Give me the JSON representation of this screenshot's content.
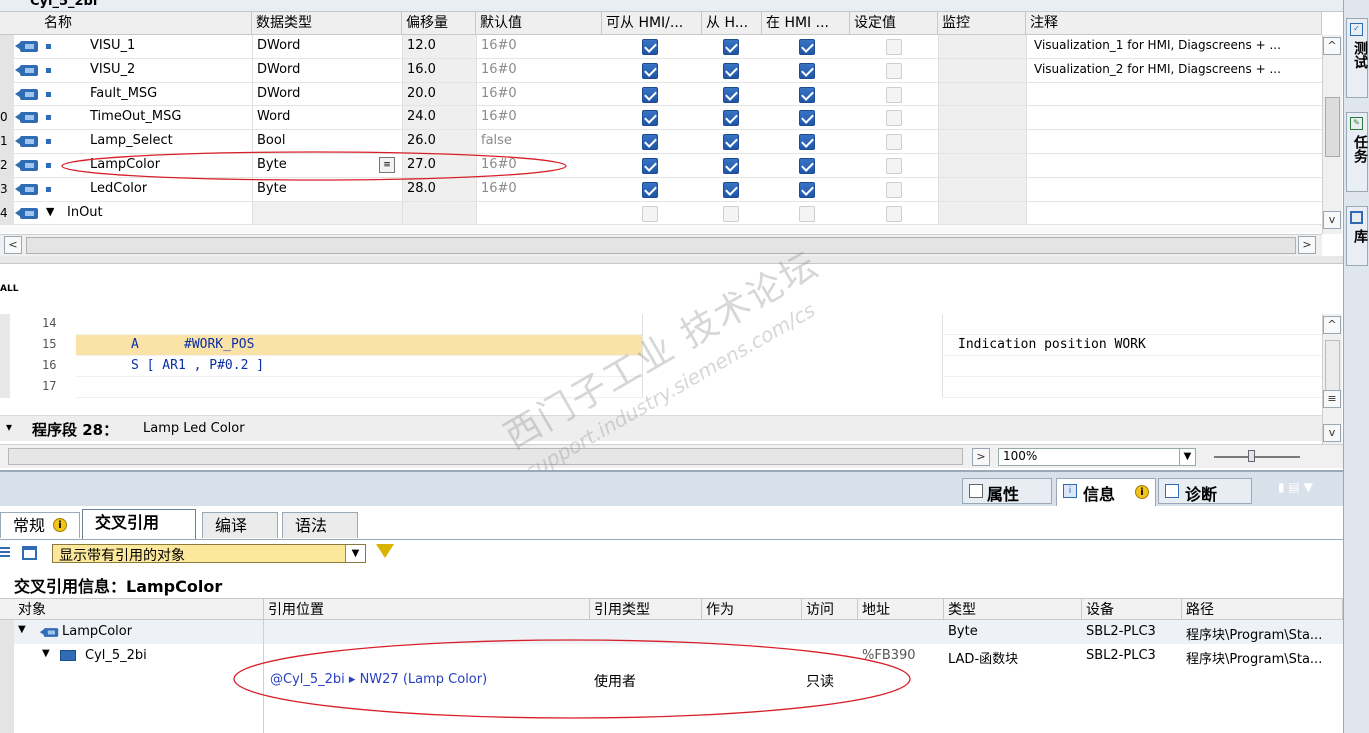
{
  "top_title": "Cyl_5_2bi",
  "interface_table": {
    "headers": [
      "名称",
      "数据类型",
      "偏移量",
      "默认值",
      "可从 HMI/...",
      "从 H...",
      "在 HMI ...",
      "设定值",
      "监控",
      "注释"
    ],
    "rows": [
      {
        "num": "",
        "name": "VISU_1",
        "type": "DWord",
        "offset": "12.0",
        "default": "16#0",
        "hmi1": true,
        "hmi2": true,
        "hmi3": true,
        "comment": "Visualization_1 for HMI, Diagscreens + ..."
      },
      {
        "num": "",
        "name": "VISU_2",
        "type": "DWord",
        "offset": "16.0",
        "default": "16#0",
        "hmi1": true,
        "hmi2": true,
        "hmi3": true,
        "comment": "Visualization_2 for HMI, Diagscreens + ..."
      },
      {
        "num": "",
        "name": "Fault_MSG",
        "type": "DWord",
        "offset": "20.0",
        "default": "16#0",
        "hmi1": true,
        "hmi2": true,
        "hmi3": true,
        "comment": ""
      },
      {
        "num": "0",
        "name": "TimeOut_MSG",
        "type": "Word",
        "offset": "24.0",
        "default": "16#0",
        "hmi1": true,
        "hmi2": true,
        "hmi3": true,
        "comment": ""
      },
      {
        "num": "1",
        "name": "Lamp_Select",
        "type": "Bool",
        "offset": "26.0",
        "default": "false",
        "hmi1": true,
        "hmi2": true,
        "hmi3": true,
        "comment": ""
      },
      {
        "num": "2",
        "name": "LampColor",
        "type": "Byte",
        "offset": "27.0",
        "default": "16#0",
        "hmi1": true,
        "hmi2": true,
        "hmi3": true,
        "comment": ""
      },
      {
        "num": "3",
        "name": "LedColor",
        "type": "Byte",
        "offset": "28.0",
        "default": "16#0",
        "hmi1": true,
        "hmi2": true,
        "hmi3": true,
        "comment": ""
      },
      {
        "num": "4",
        "name": "InOut",
        "type": "",
        "offset": "",
        "default": "",
        "hmi1": false,
        "hmi2": false,
        "hmi3": false,
        "comment": ""
      }
    ]
  },
  "side_tabs": [
    "测试",
    "任务",
    "库"
  ],
  "code": {
    "call_label": "ALL",
    "lines": [
      {
        "num": "14",
        "op": "",
        "arg": "",
        "comment": ""
      },
      {
        "num": "15",
        "op": "A",
        "arg": "#WORK_POS",
        "comment": "Indication position WORK"
      },
      {
        "num": "16",
        "op": "S [ AR1 , P#0.2 ]",
        "arg": "",
        "comment": ""
      },
      {
        "num": "17",
        "op": "",
        "arg": "",
        "comment": ""
      }
    ],
    "network_label": "程序段 28：",
    "network_title": "Lamp Led Color",
    "zoom": "100%"
  },
  "watermark": {
    "line1": "西门子工业 技术论坛",
    "line2": "support.industry.siemens.com/cs"
  },
  "inspector_tabs": {
    "properties": "属性",
    "info": "信息",
    "diagnostics": "诊断"
  },
  "info_tabs": [
    "常规",
    "交叉引用",
    "编译",
    "语法"
  ],
  "filter": {
    "selected": "显示带有引用的对象"
  },
  "xref": {
    "title": "交叉引用信息：LampColor",
    "headers": [
      "对象",
      "引用位置",
      "引用类型",
      "作为",
      "访问",
      "地址",
      "类型",
      "设备",
      "路径"
    ],
    "rows": [
      {
        "object": "LampColor",
        "location": "",
        "reftype": "",
        "as": "",
        "access": "",
        "address": "",
        "type": "Byte",
        "device": "SBL2-PLC3",
        "path": "程序块\\Program\\Sta..."
      },
      {
        "object": "Cyl_5_2bi",
        "location": "",
        "reftype": "",
        "as": "",
        "access": "",
        "address": "%FB390",
        "type": "LAD-函数块",
        "device": "SBL2-PLC3",
        "path": "程序块\\Program\\Sta..."
      },
      {
        "object": "",
        "location": "@Cyl_5_2bi ▸ NW27 (Lamp Color)",
        "reftype": "使用者",
        "as": "",
        "access": "只读",
        "address": "",
        "type": "",
        "device": "",
        "path": ""
      }
    ]
  }
}
